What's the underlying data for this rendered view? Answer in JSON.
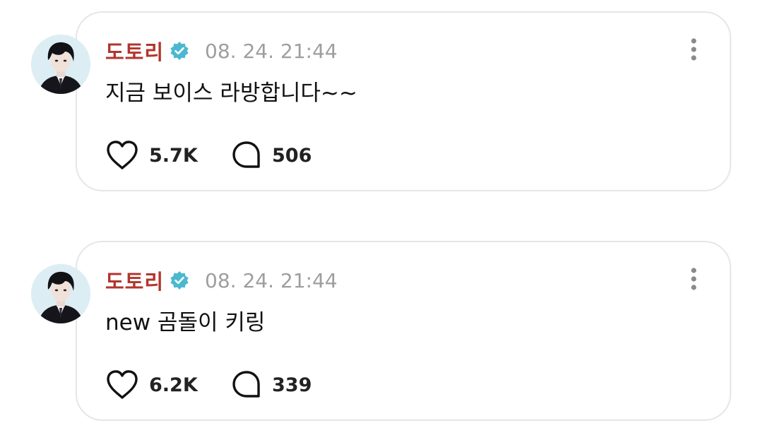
{
  "posts": [
    {
      "author": "도토리",
      "verified": true,
      "timestamp": "08. 24. 21:44",
      "text": "지금 보이스 라방합니다~~",
      "likes": "5.7K",
      "comments": "506"
    },
    {
      "author": "도토리",
      "verified": true,
      "timestamp": "08. 24. 21:44",
      "text": "new 곰돌이 키링",
      "likes": "6.2K",
      "comments": "339"
    }
  ],
  "icons": {
    "verified": "verified-badge-icon",
    "more": "more-vertical-icon",
    "like": "heart-icon",
    "comment": "comment-bubble-icon"
  },
  "colors": {
    "author_name": "#b2352c",
    "verified_badge": "#4bb8cf",
    "timestamp": "#9e9e9e",
    "card_border": "#e6e6e6"
  }
}
